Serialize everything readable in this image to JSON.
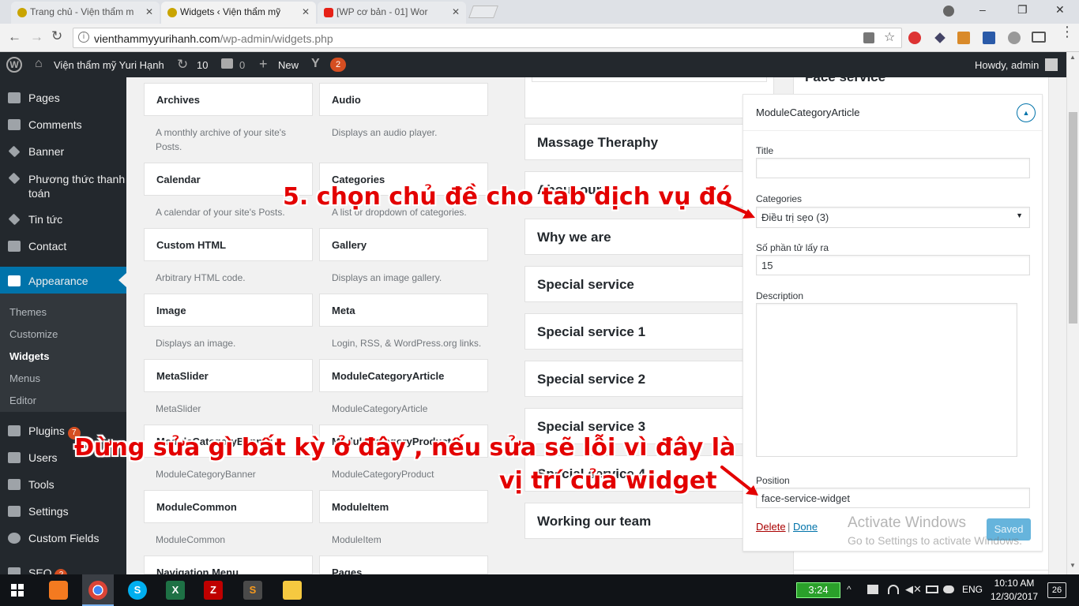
{
  "browser": {
    "tabs": [
      {
        "label": "Trang chủ - Viện thẩm m"
      },
      {
        "label": "Widgets ‹ Viện thẩm mỹ"
      },
      {
        "label": "[WP cơ bản - 01] Wor"
      }
    ],
    "url_host": "vienthammyyurihanh.com",
    "url_path": "/wp-admin/widgets.php"
  },
  "adminbar": {
    "site_name": "Viện thẩm mỹ Yuri Hạnh",
    "updates_count": "10",
    "comments_count": "0",
    "new_label": "New",
    "yoast_badge": "2",
    "howdy": "Howdy, admin"
  },
  "sidebar": {
    "items": [
      {
        "label": "Pages",
        "icon": "pages-icon"
      },
      {
        "label": "Comments",
        "icon": "comments-icon"
      },
      {
        "label": "Banner",
        "icon": "pin-icon"
      },
      {
        "label": "Phương thức thanh",
        "label2": "toán",
        "icon": "pin-icon"
      },
      {
        "label": "Tin tức",
        "icon": "pin-icon"
      },
      {
        "label": "Contact",
        "icon": "mail-icon"
      },
      {
        "label": "Appearance",
        "icon": "brush-icon"
      }
    ],
    "submenu": [
      "Themes",
      "Customize",
      "Widgets",
      "Menus",
      "Editor"
    ],
    "bottom": [
      {
        "label": "Plugins",
        "badge": "7",
        "icon": "plugin-icon"
      },
      {
        "label": "Users",
        "icon": "users-icon"
      },
      {
        "label": "Tools",
        "icon": "tools-icon"
      },
      {
        "label": "Settings",
        "icon": "settings-icon"
      },
      {
        "label": "Custom Fields",
        "icon": "custom-fields-icon"
      },
      {
        "label": "SEO",
        "badge": "2",
        "icon": "seo-icon"
      }
    ]
  },
  "widgets": [
    {
      "name": "Archives",
      "desc": "A monthly archive of your site's Posts."
    },
    {
      "name": "Audio",
      "desc": "Displays an audio player."
    },
    {
      "name": "Calendar",
      "desc": "A calendar of your site's Posts."
    },
    {
      "name": "Categories",
      "desc": "A list or dropdown of categories."
    },
    {
      "name": "Custom HTML",
      "desc": "Arbitrary HTML code."
    },
    {
      "name": "Gallery",
      "desc": "Displays an image gallery."
    },
    {
      "name": "Image",
      "desc": "Displays an image."
    },
    {
      "name": "Meta",
      "desc": "Login, RSS, & WordPress.org links."
    },
    {
      "name": "MetaSlider",
      "desc": "MetaSlider"
    },
    {
      "name": "ModuleCategoryArticle",
      "desc": "ModuleCategoryArticle"
    },
    {
      "name": "ModuleCategoryBanner",
      "desc": "ModuleCategoryBanner"
    },
    {
      "name": "ModuleCategoryProduct",
      "desc": "ModuleCategoryProduct"
    },
    {
      "name": "ModuleCommon",
      "desc": "ModuleCommon"
    },
    {
      "name": "ModuleItem",
      "desc": "ModuleItem"
    },
    {
      "name": "Navigation Menu",
      "desc": ""
    },
    {
      "name": "Pages",
      "desc": ""
    }
  ],
  "areas": [
    "Massage Theraphy",
    "About our",
    "Why we are",
    "Special service",
    "Special service 1",
    "Special service 2",
    "Special service 3",
    "Special service 4",
    "Working our team"
  ],
  "right_area_title": "Face service",
  "form": {
    "widget_title": "ModuleCategoryArticle",
    "title_label": "Title",
    "title_value": "",
    "categories_label": "Categories",
    "categories_value": "Điều trị sẹo  (3)",
    "count_label": "Số phần tử lấy ra",
    "count_value": "15",
    "description_label": "Description",
    "position_label": "Position",
    "position_value": "face-service-widget",
    "delete_label": "Delete",
    "separator": "|",
    "done_label": "Done",
    "saved_label": "Saved"
  },
  "watermark": {
    "line1": "Activate Windows",
    "line2": "Go to Settings to activate Windows."
  },
  "annotations": {
    "step5": "5. chọn chủ đề cho tab dịch vụ đó",
    "warning_line1": "Đừng sửa gì bất kỳ ở đây , nếu sửa sẽ lỗi vì đây là",
    "warning_line2": "vị trí của widget"
  },
  "taskbar": {
    "timer": "3:24",
    "lang": "ENG",
    "time": "10:10 AM",
    "date": "12/30/2017",
    "notif": "26"
  },
  "colors": {
    "accent": "#0073aa",
    "adminbar": "#23282d",
    "annotation": "#e30000",
    "badge": "#d54e21"
  }
}
